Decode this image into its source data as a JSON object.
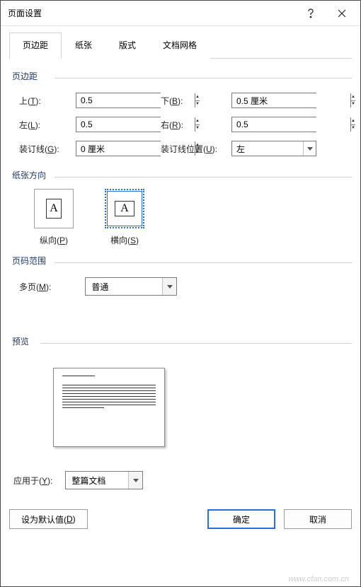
{
  "title": "页面设置",
  "tabs": {
    "t0": "页边距",
    "t1": "纸张",
    "t2": "版式",
    "t3": "文档网格"
  },
  "group": {
    "margins": "页边距",
    "orient": "纸张方向",
    "pages": "页码范围",
    "preview": "预览"
  },
  "labels": {
    "top": "上(T):",
    "bottom": "下(B):",
    "left": "左(L):",
    "right": "右(R):",
    "gutter": "装订线(G):",
    "gutter_pos": "装订线位置(U):",
    "multi": "多页(M):",
    "apply": "应用于(Y):"
  },
  "values": {
    "top": "0.5",
    "bottom": "0.5 厘米",
    "left": "0.5",
    "right": "0.5",
    "gutter": "0 厘米",
    "gutter_pos": "左",
    "multi": "普通",
    "apply": "整篇文档"
  },
  "orient": {
    "portrait": "纵向(P)",
    "landscape": "横向(S)",
    "glyph": "A",
    "selected": "landscape"
  },
  "buttons": {
    "default": "设为默认值(D)",
    "ok": "确定",
    "cancel": "取消"
  },
  "watermark": "www.cfan.com.cn"
}
